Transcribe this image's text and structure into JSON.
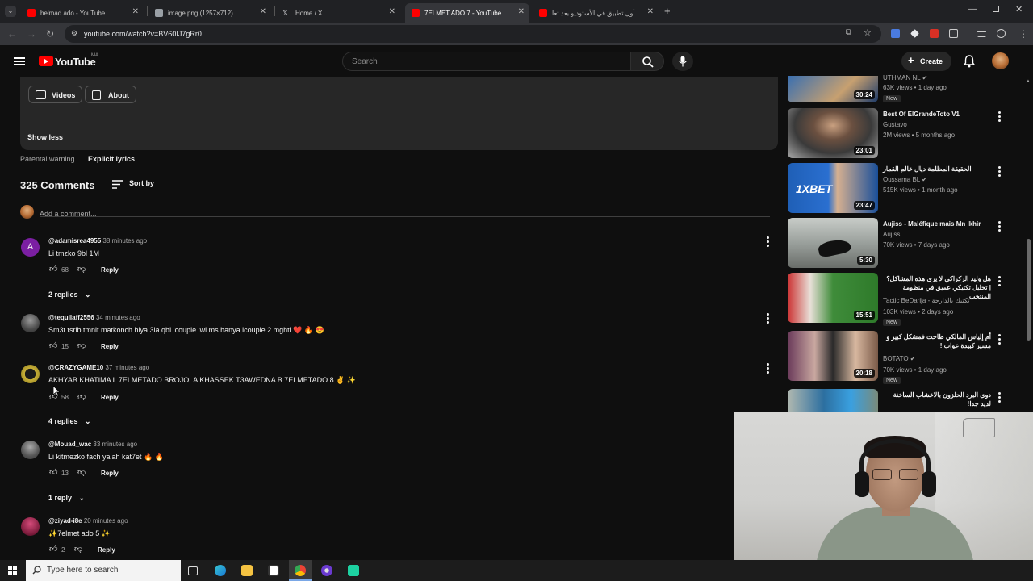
{
  "browser": {
    "tabs": [
      {
        "title": "helmad ado - YouTube",
        "favicon_color": "#ff0000",
        "active": false
      },
      {
        "title": "image.png (1257×712)",
        "favicon_color": "#9aa0a6",
        "active": false
      },
      {
        "title": "Home / X",
        "favicon_color": "#e8eaed",
        "active": false
      },
      {
        "title": "7ELMET ADO 7 - YouTube",
        "favicon_color": "#ff0000",
        "active": true
      },
      {
        "title": "أول تطبيق في الأستوديو بعد تعا...",
        "favicon_color": "#ff0000",
        "active": false
      }
    ],
    "url": "youtube.com/watch?v=BV60IJ7gRr0"
  },
  "youtube_header": {
    "logo_text": "YouTube",
    "country_code": "MA",
    "search_placeholder": "Search",
    "create_label": "Create"
  },
  "description": {
    "pills": [
      {
        "label": "Videos",
        "icon": "video-icon"
      },
      {
        "label": "About",
        "icon": "person-icon"
      }
    ],
    "show_less": "Show less",
    "parental_warning_label": "Parental warning",
    "parental_warning_value": "Explicit lyrics"
  },
  "comments_header": {
    "count": "325 Comments",
    "sort_label": "Sort by",
    "add_placeholder": "Add a comment..."
  },
  "comments": [
    {
      "author": "@adamisrea4955",
      "time": "38 minutes ago",
      "text": "Li tmzko  9bl 1M",
      "likes": "68",
      "replies": "2 replies",
      "avatar_color": "#7b1fa2",
      "avatar_letter": "A"
    },
    {
      "author": "@tequilaff2556",
      "time": "34 minutes ago",
      "text": "Sm3t tsrib tmnit matkonch hiya 3la qbl lcouple lwl ms hanya lcouple 2 mghti ❤️ 🔥 😍",
      "likes": "15",
      "replies": "",
      "avatar_color": "#555555",
      "avatar_letter": ""
    },
    {
      "author": "@CRAZYGAME10",
      "time": "37 minutes ago",
      "text": "AKHYAB KHATIMA L 7ELMETADO BROJOLA KHASSEK T3AWEDNA B 7ELMETADO 8 ✌️ ✨",
      "likes": "58",
      "replies": "4 replies",
      "avatar_color": "#c9b037",
      "avatar_letter": ""
    },
    {
      "author": "@Mouad_wac",
      "time": "33 minutes ago",
      "text": "Li kitmezko fach yalah kat7et 🔥 🔥",
      "likes": "13",
      "replies": "1 reply",
      "avatar_color": "#666666",
      "avatar_letter": ""
    },
    {
      "author": "@ziyad-i8e",
      "time": "20 minutes ago",
      "text": "✨7elmet ado 5 ✨",
      "likes": "2",
      "replies": "",
      "avatar_color": "#9c2b4a",
      "avatar_letter": ""
    }
  ],
  "reply_label": "Reply",
  "sidebar_videos": [
    {
      "title": "",
      "channel": "UTHMAN NL ✔",
      "meta": "63K views • 1 day ago",
      "new": "New",
      "duration": "30:24",
      "thumb_color": "#3a6fb0"
    },
    {
      "title": "Best Of ElGrandeToto V1",
      "channel": "Gustavo",
      "meta": "2M views • 5 months ago",
      "new": "",
      "duration": "23:01",
      "thumb_color": "#6b6b6b"
    },
    {
      "title": "الحقيقة المظلمة ديال عالم القمار",
      "channel": "Oussama BL ✔",
      "meta": "515K views • 1 month ago",
      "new": "",
      "duration": "23:47",
      "thumb_color": "#1f5fb6"
    },
    {
      "title": "Aujiss - Maléfique mais Mn lkhir",
      "channel": "Aujiss",
      "meta": "70K views • 7 days ago",
      "new": "",
      "duration": "5:30",
      "thumb_color": "#9aa09c"
    },
    {
      "title": "هل وليد الركراكي لا يرى هذه المشاكل؟ | تحليل تكتيكي عميق في منظومة المنتخب",
      "channel": "Tactic BeDarija - تكتيك بالدارجة",
      "meta": "103K views • 2 days ago",
      "new": "New",
      "duration": "15:51",
      "thumb_color": "#3f8c3a"
    },
    {
      "title": "أم إلياس المالكي طاحت فمشكل كبير و مسير كبيدة عواب !",
      "channel": "BOTATO ✔",
      "meta": "70K views • 1 day ago",
      "new": "New",
      "duration": "20:18",
      "thumb_color": "#7a5a48"
    },
    {
      "title": "دوى البرد الحلزون بالاعشاب الساخنة لديد جدا!",
      "channel": "",
      "meta": "",
      "new": "",
      "duration": "",
      "thumb_color": "#2c6fa0"
    }
  ],
  "taskbar": {
    "search_placeholder": "Type here to search"
  }
}
